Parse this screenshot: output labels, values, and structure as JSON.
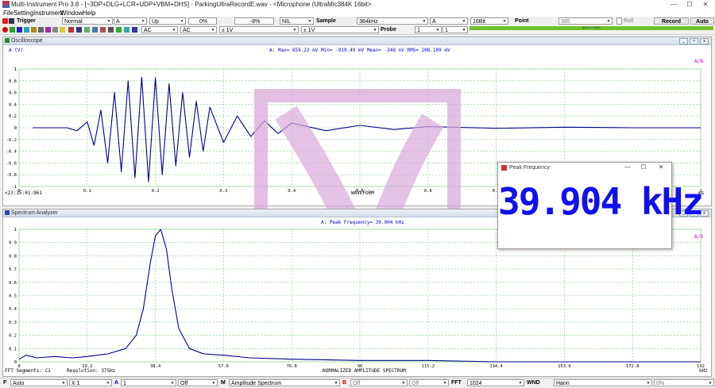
{
  "titlebar": {
    "title": "Multi-Instrument Pro 3.8  -  [~3DP+DLG+LCR+UDP+VBM+DHS]  -  ParkingUltraRecordE.wav  -  <Microphone (UltraMic384K 16bit>",
    "minimize": "—",
    "maximize": "☐",
    "close": "✕"
  },
  "menu": [
    "File",
    "Setting",
    "Instrument",
    "Window",
    "Help"
  ],
  "toolbar1": {
    "trigger_label": "Trigger",
    "mode": "Normal",
    "channel": "A",
    "slope": "Up",
    "level": "0%",
    "delay": "-8%",
    "nil": "NIL",
    "sample_label": "Sample",
    "sample_rate": "384kHz",
    "channel2": "A",
    "bits": "16Bit",
    "point_label": "Point",
    "points": "385",
    "roll_label": "Roll",
    "record_label": "Record",
    "auto_label": "Auto"
  },
  "toolbar2": {
    "coupling_a": "AC",
    "coupling_b": "AC",
    "range_a": "± 1V",
    "range_b": "± 1V",
    "probe_label": "Probe",
    "probe_a": "1",
    "probe_b": "1",
    "progress_text": "80% 27 8MS",
    "progress_fraction": 1.0
  },
  "oscilloscope": {
    "panel_title": "Oscilloscope",
    "y_unit": "A (V)",
    "stats": "A: Max= 859.22 mV  Min= -919.49 mV  Mean=   -348 nV  RMS=  208.109 mV",
    "y_ticks": [
      "1",
      "0.8",
      "0.6",
      "0.4",
      "0.2",
      "0",
      "-0.2",
      "-0.4",
      "-0.6",
      "-0.8",
      "-1"
    ],
    "x_ticks": [
      "0",
      "0.1",
      "0.2",
      "0.3",
      "0.4",
      "0.5",
      "0.6",
      "0.7",
      "0.8",
      "1"
    ],
    "x_unit": "ms",
    "timestamp": "<23:15:01:961",
    "x_label": "WAVEFORM",
    "corner": "A/B"
  },
  "spectrum": {
    "panel_title": "Spectrum Analyzer",
    "peak_text": "A: Peak Frequency= 39.904 kHz",
    "y_ticks": [
      "1",
      "0.9",
      "0.8",
      "0.7",
      "0.6",
      "0.5",
      "0.4",
      "0.3",
      "0.2",
      "0.1",
      "0"
    ],
    "x_ticks": [
      "0",
      "19.2",
      "38.4",
      "57.6",
      "76.8",
      "96",
      "115.2",
      "134.4",
      "153.6",
      "172.8",
      "192"
    ],
    "x_unit": "kHz",
    "segments": "FFT Segments: C1",
    "resolution": "Resolution: 375Hz",
    "x_label": "NORMALIZED AMPLITUDE SPECTRUM",
    "corner": "A/B"
  },
  "popup": {
    "title": "Peak Frequency",
    "value": "39.904 kHz"
  },
  "bottombar": {
    "f_label": "F",
    "f_value": "Auto",
    "x_value": "X 1",
    "a_label": "A",
    "a_value": "1",
    "off1": "Off",
    "m_label": "M",
    "m_value": "Amplitude Spectrum",
    "b_label": "B",
    "off2": "Off",
    "off3": "Off",
    "fft_label": "FFT",
    "fft_value": "1024",
    "wnd_label": "WND",
    "wnd_value": "Hann",
    "pct": "0%"
  },
  "chart_data": [
    {
      "type": "line",
      "title": "",
      "xlabel": "WAVEFORM",
      "ylabel": "A (V)",
      "xlim": [
        0,
        1
      ],
      "ylim": [
        -1,
        1
      ],
      "grid": true,
      "series": [
        {
          "name": "A",
          "color": "#00008b",
          "x": [
            0.02,
            0.05,
            0.07,
            0.085,
            0.1,
            0.11,
            0.12,
            0.13,
            0.14,
            0.15,
            0.16,
            0.17,
            0.18,
            0.19,
            0.2,
            0.21,
            0.22,
            0.23,
            0.24,
            0.25,
            0.26,
            0.27,
            0.28,
            0.3,
            0.32,
            0.34,
            0.36,
            0.38,
            0.4,
            0.45,
            0.5,
            0.55,
            0.6,
            0.7,
            0.8,
            0.9,
            1.0
          ],
          "y": [
            0,
            0,
            0,
            -0.05,
            0.1,
            -0.3,
            0.3,
            -0.6,
            0.6,
            -0.75,
            0.8,
            -0.85,
            0.86,
            -0.92,
            0.85,
            -0.8,
            0.75,
            -0.65,
            0.6,
            -0.5,
            0.45,
            -0.4,
            0.35,
            -0.25,
            0.2,
            -0.15,
            0.12,
            -0.1,
            0.08,
            -0.05,
            0.04,
            -0.03,
            0.02,
            -0.01,
            0.01,
            0,
            0
          ]
        }
      ]
    },
    {
      "type": "line",
      "title": "",
      "xlabel": "NORMALIZED AMPLITUDE SPECTRUM",
      "ylabel": "",
      "xlim": [
        0,
        192
      ],
      "ylim": [
        0,
        1
      ],
      "grid": true,
      "series": [
        {
          "name": "A",
          "color": "#00008b",
          "x": [
            0,
            2,
            5,
            10,
            15,
            19.2,
            25,
            30,
            33,
            35,
            37,
            38.4,
            39.9,
            41.5,
            43,
            45,
            48,
            52,
            57.6,
            65,
            76.8,
            96,
            115.2,
            134.4,
            153.6,
            172.8,
            192
          ],
          "y": [
            0.02,
            0.05,
            0.03,
            0.04,
            0.03,
            0.04,
            0.06,
            0.1,
            0.2,
            0.4,
            0.75,
            0.95,
            1.0,
            0.85,
            0.55,
            0.25,
            0.1,
            0.06,
            0.05,
            0.03,
            0.02,
            0.01,
            0.01,
            0.0,
            0.0,
            0.0,
            0.0
          ]
        }
      ]
    }
  ]
}
